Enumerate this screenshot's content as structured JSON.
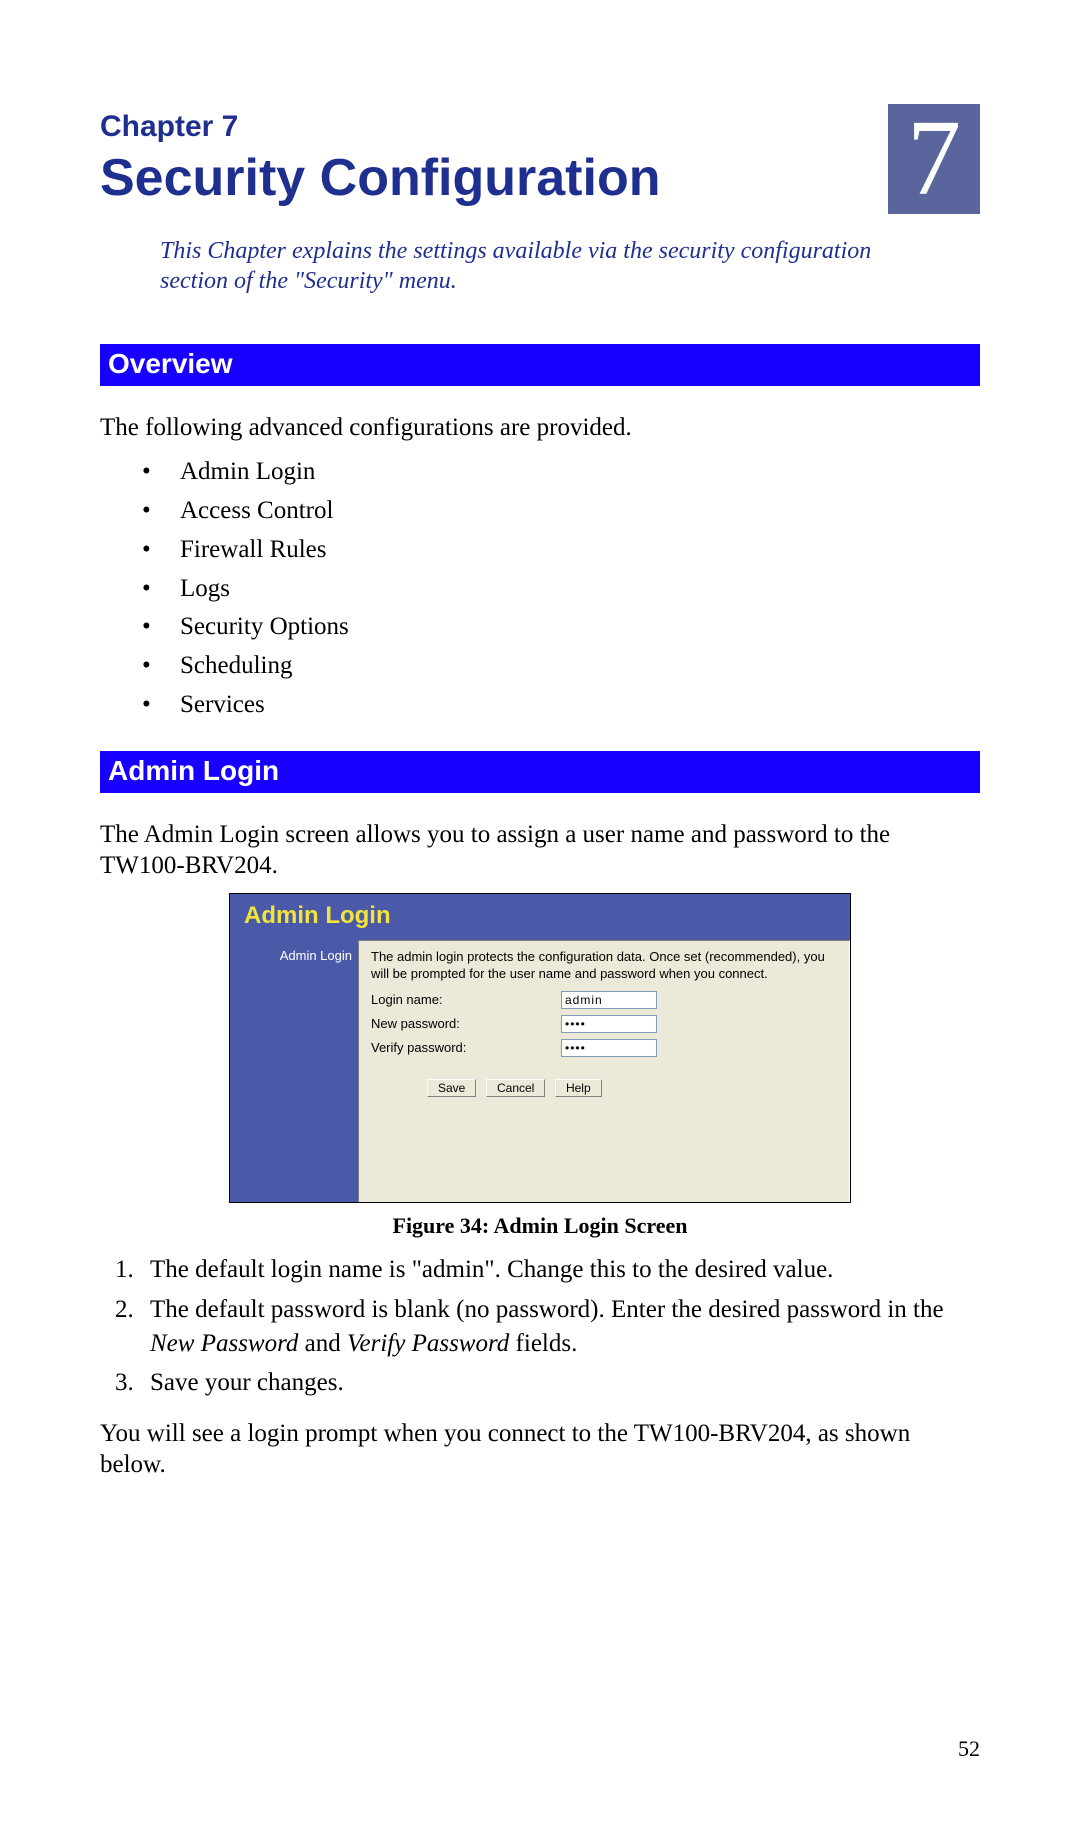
{
  "chapter": {
    "label": "Chapter 7",
    "title": "Security Configuration",
    "number": "7",
    "intro": "This Chapter explains the settings available via the security configuration section of the \"Security\" menu."
  },
  "overview": {
    "heading": "Overview",
    "lead": "The following advanced configurations are provided.",
    "items": [
      "Admin Login",
      "Access Control",
      "Firewall Rules",
      "Logs",
      "Security Options",
      "Scheduling",
      "Services"
    ]
  },
  "admin_section": {
    "heading": "Admin Login",
    "lead": "The Admin Login screen allows you to assign a user name and password to the TW100-BRV204."
  },
  "screenshot": {
    "title": "Admin Login",
    "side_label": "Admin Login",
    "description": "The admin login protects the configuration data. Once set (recommended), you will be prompted for the user name and password when you connect.",
    "fields": {
      "login_label": "Login name:",
      "login_value": "admin",
      "newpass_label": "New password:",
      "newpass_value": "••••",
      "verify_label": "Verify password:",
      "verify_value": "••••"
    },
    "buttons": {
      "save": "Save",
      "cancel": "Cancel",
      "help": "Help"
    }
  },
  "figure_caption": "Figure 34: Admin Login Screen",
  "steps": {
    "s1": "The default login name is \"admin\". Change this to the desired value.",
    "s2_a": "The default password is blank (no password). Enter the desired password in the ",
    "s2_i1": "New Password",
    "s2_mid": " and ",
    "s2_i2": "Verify Password",
    "s2_b": " fields.",
    "s3": "Save your changes."
  },
  "closing": "You will see a login prompt when you connect to the TW100-BRV204, as shown below.",
  "page_number": "52"
}
